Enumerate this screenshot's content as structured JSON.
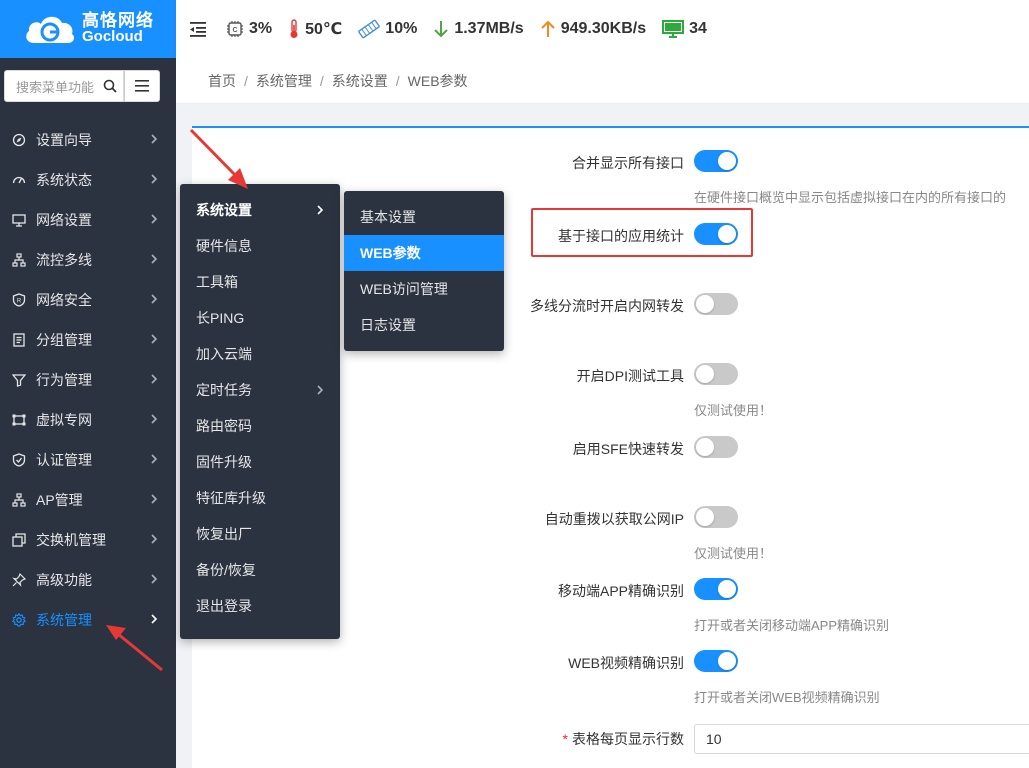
{
  "brand": {
    "name_cn": "高恪网络",
    "name_en": "Gocloud",
    "color": "#1890ff"
  },
  "search": {
    "placeholder": "搜索菜单功能"
  },
  "topbar": {
    "cpu": "3%",
    "temperature": "50℃",
    "memory": "10%",
    "download": "1.37MB/s",
    "upload": "949.30KB/s",
    "clients": "34"
  },
  "sidebar": {
    "items": [
      {
        "label": "设置向导",
        "icon": "compass-icon"
      },
      {
        "label": "系统状态",
        "icon": "dashboard-icon"
      },
      {
        "label": "网络设置",
        "icon": "monitor-icon"
      },
      {
        "label": "流控多线",
        "icon": "network-icon"
      },
      {
        "label": "网络安全",
        "icon": "shield-icon"
      },
      {
        "label": "分组管理",
        "icon": "group-icon"
      },
      {
        "label": "行为管理",
        "icon": "filter-icon"
      },
      {
        "label": "虚拟专网",
        "icon": "vpn-icon"
      },
      {
        "label": "认证管理",
        "icon": "check-shield-icon"
      },
      {
        "label": "AP管理",
        "icon": "ap-icon"
      },
      {
        "label": "交换机管理",
        "icon": "switch-icon"
      },
      {
        "label": "高级功能",
        "icon": "pin-icon"
      },
      {
        "label": "系统管理",
        "icon": "gear-icon",
        "active": true
      }
    ]
  },
  "submenu": {
    "items": [
      "系统设置",
      "硬件信息",
      "工具箱",
      "长PING",
      "加入云端",
      "定时任务",
      "路由密码",
      "固件升级",
      "特征库升级",
      "恢复出厂",
      "备份/恢复",
      "退出登录"
    ]
  },
  "submenu2": {
    "items": [
      "基本设置",
      "WEB参数",
      "WEB访问管理",
      "日志设置"
    ],
    "selected": "WEB参数"
  },
  "breadcrumb": [
    "首页",
    "系统管理",
    "系统设置",
    "WEB参数"
  ],
  "settings": [
    {
      "label": "合并显示所有接口",
      "on": true,
      "hint": "在硬件接口概览中显示包括虚拟接口在内的所有接口的"
    },
    {
      "label": "基于接口的应用统计",
      "on": true,
      "hint": ""
    },
    {
      "label": "多线分流时开启内网转发",
      "on": false,
      "hint": ""
    },
    {
      "label": "开启DPI测试工具",
      "on": false,
      "hint": "仅测试使用！"
    },
    {
      "label": "启用SFE快速转发",
      "on": false,
      "hint": ""
    },
    {
      "label": "自动重拨以获取公网IP",
      "on": false,
      "hint": "仅测试使用！"
    },
    {
      "label": "移动端APP精确识别",
      "on": true,
      "hint": "打开或者关闭移动端APP精确识别"
    },
    {
      "label": "WEB视频精确识别",
      "on": true,
      "hint": "打开或者关闭WEB视频精确识别"
    }
  ],
  "rows_per_page": {
    "required_mark": "*",
    "label": "表格每页显示行数",
    "value": "10"
  },
  "colors": {
    "sidebar_bg": "#2b3340",
    "accent": "#1890ff",
    "annotation_red": "#e53935"
  }
}
